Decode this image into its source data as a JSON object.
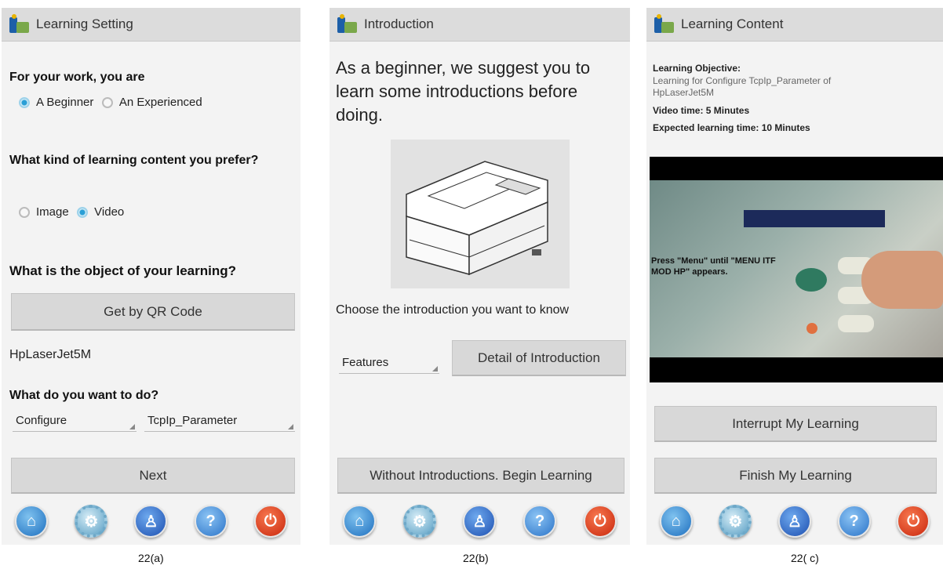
{
  "screen_a": {
    "title": "Learning Setting",
    "q1": "For your work, you are",
    "q1_options": [
      "A Beginner",
      "An Experienced"
    ],
    "q2": "What kind of learning content you prefer?",
    "q2_options": [
      "Image",
      "Video"
    ],
    "q3": "What is the object of your learning?",
    "qr_button": "Get by QR Code",
    "object_value": "HpLaserJet5M",
    "q4": "What do you want to do?",
    "action_select": "Configure",
    "param_select": "TcpIp_Parameter",
    "next_button": "Next"
  },
  "screen_b": {
    "title": "Introduction",
    "message": "As a beginner, we suggest you to learn some introductions before doing.",
    "choose_label": "Choose the introduction you want to know",
    "intro_select": "Features",
    "detail_button": "Detail of Introduction",
    "skip_button": "Without Introductions. Begin Learning"
  },
  "screen_c": {
    "title": "Learning Content",
    "objective_label": "Learning Objective:",
    "objective_value": "Learning for Configure TcpIp_Parameter of HpLaserJet5M",
    "video_time": "Video time: 5 Minutes",
    "expected_time": "Expected learning time: 10 Minutes",
    "video_overlay": "Press \"Menu\" until \"MENU ITF MOD HP\" appears.",
    "interrupt_button": "Interrupt My Learning",
    "finish_button": "Finish My Learning"
  },
  "dock_icons": [
    "home-icon",
    "settings-icon",
    "user-icon",
    "help-icon",
    "power-icon"
  ],
  "captions": [
    "22(a)",
    "22(b)",
    "22( c)"
  ],
  "colors": {
    "radio_accent": "#2a9fd6",
    "button_bg": "#d8d8d8",
    "power": "#c9260c"
  }
}
